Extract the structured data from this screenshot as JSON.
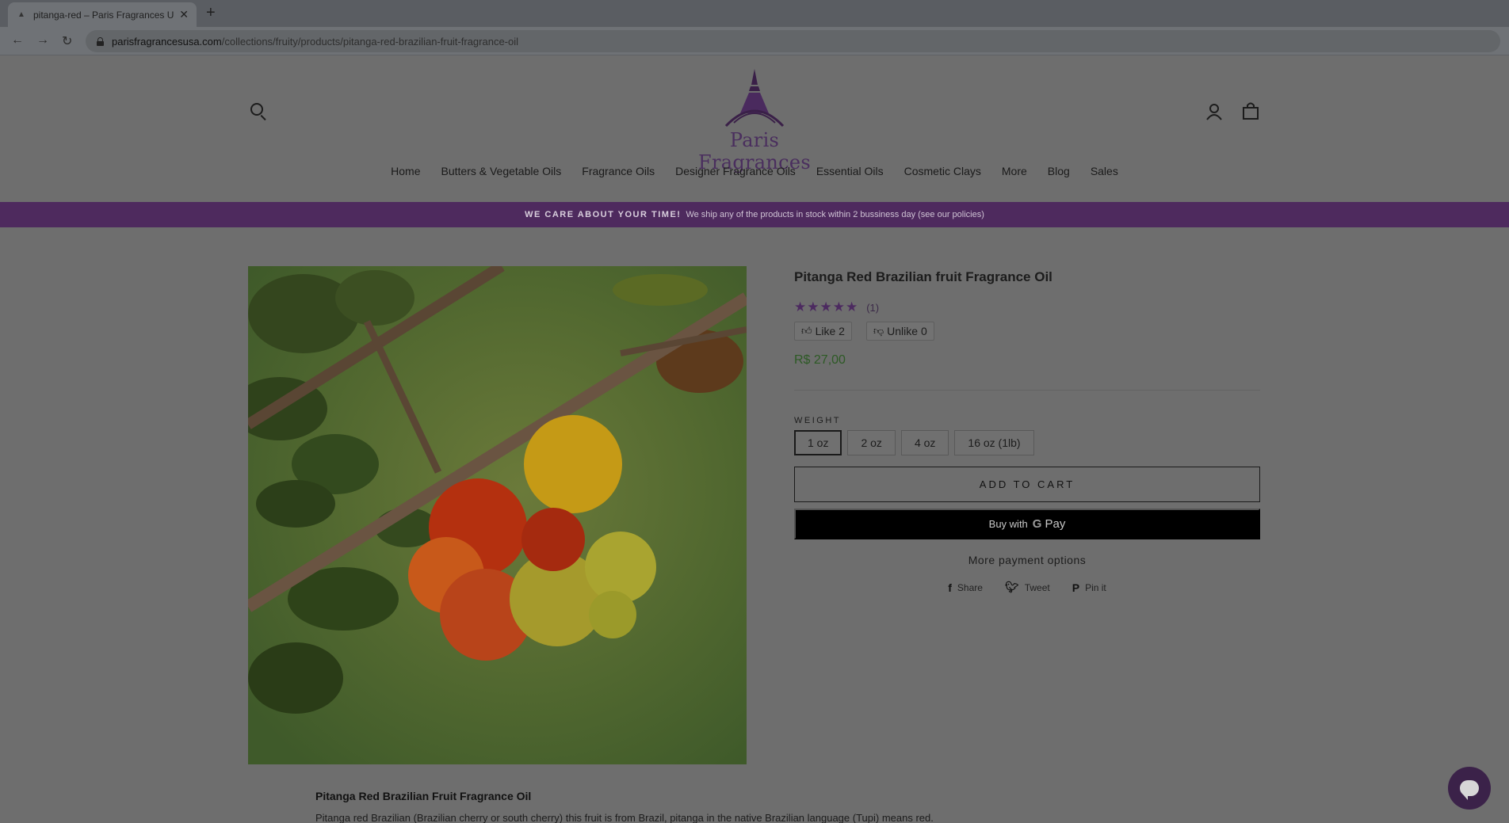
{
  "browser": {
    "tab_title": "pitanga-red – Paris Fragrances U",
    "url_host": "parisfragrancesusa.com",
    "url_path": "/collections/fruity/products/pitanga-red-brazilian-fruit-fragrance-oil"
  },
  "header": {
    "logo_text": "Paris Fragrances",
    "nav": [
      "Home",
      "Butters & Vegetable Oils",
      "Fragrance Oils",
      "Designer Fragrance Oils",
      "Essential Oils",
      "Cosmetic Clays",
      "More",
      "Blog",
      "Sales"
    ]
  },
  "announcement": {
    "bold": "WE CARE ABOUT YOUR TIME!",
    "text": "We ship any of the products in stock within 2 bussiness day (see our policies)"
  },
  "product": {
    "title": "Pitanga Red Brazilian fruit Fragrance Oil",
    "stars": "★★★★★",
    "rating_count": "(1)",
    "like_label": "Like 2",
    "unlike_label": "Unlike 0",
    "price": "R$ 27,00",
    "option_label": "WEIGHT",
    "variants": [
      "1 oz",
      "2 oz",
      "4 oz",
      "16 oz (1lb)"
    ],
    "selected_variant": "1 oz",
    "add_to_cart": "ADD TO CART",
    "buy_with": "Buy with",
    "gpay_g": "G",
    "gpay_pay": "Pay",
    "more_payment": "More payment options",
    "share": "Share",
    "tweet": "Tweet",
    "pin": "Pin it",
    "desc_title": "Pitanga Red Brazilian Fruit Fragrance Oil",
    "desc_text": "Pitanga red Brazilian (Brazilian cherry or south cherry) this fruit is from Brazil, pitanga in the native Brazilian language (Tupi) means red."
  },
  "colors": {
    "accent": "#4e2a5e",
    "price": "#2d5a25",
    "overlay_bg": "#6e6e6e"
  }
}
